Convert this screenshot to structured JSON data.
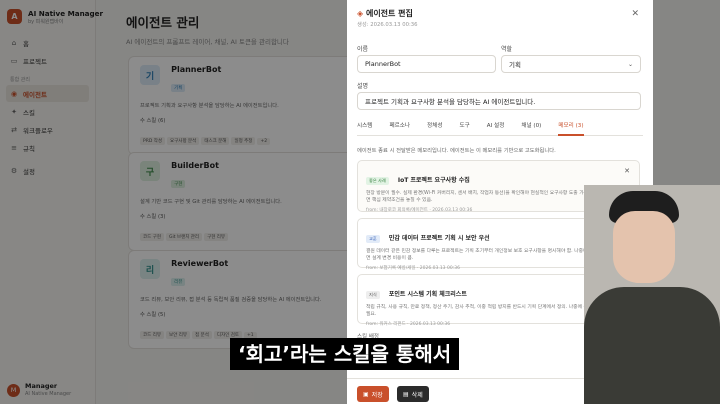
{
  "app": {
    "title": "AI Native Manager",
    "subtitle": "by 피워원랩바이"
  },
  "sidebar": {
    "items": [
      {
        "label": "홈",
        "icon": "home-icon",
        "glyph": "⌂"
      },
      {
        "label": "프로젝트",
        "icon": "folder-icon",
        "glyph": "▭"
      }
    ],
    "section_label": "통합 관리",
    "section_items": [
      {
        "label": "에이전트",
        "icon": "bot-icon",
        "glyph": "◉",
        "active": true
      },
      {
        "label": "스킬",
        "icon": "skill-icon",
        "glyph": "✦"
      },
      {
        "label": "워크플로우",
        "icon": "workflow-icon",
        "glyph": "⇄"
      },
      {
        "label": "규칙",
        "icon": "rule-icon",
        "glyph": "≡"
      },
      {
        "label": "설정",
        "icon": "gear-icon",
        "glyph": "⚙"
      }
    ]
  },
  "user": {
    "initial": "M",
    "name": "Manager",
    "role": "AI Native Manager"
  },
  "page": {
    "title": "에이전트 관리",
    "subtitle": "AI 에이전트의 프롬프트 레이어, 채널, AI 토큰을 관리합니다"
  },
  "agents": [
    {
      "initial": "기",
      "name": "PlannerBot",
      "tag": "기획",
      "color": "#2f7fb8",
      "bg": "#dcecf7",
      "desc": "프로젝트 기획과 요구사항 분석을 담당하는 AI 에이전트입니다.",
      "skills_label": "수 스킬 (6)",
      "chips": [
        "PRD 작성",
        "요구사항 분석",
        "태스크 분해",
        "일정 추정",
        "+2"
      ]
    },
    {
      "initial": "구",
      "name": "BuilderBot",
      "tag": "구현",
      "color": "#3c8a4a",
      "bg": "#dff0e1",
      "desc": "설계 기반 코드 구현 및 Git 관리를 담당하는 AI 에이전트입니다.",
      "skills_label": "수 스킬 (3)",
      "chips": [
        "코드 구현",
        "Git 브랜치 관리",
        "구현 리뷰"
      ]
    },
    {
      "initial": "리",
      "name": "ReviewerBot",
      "tag": "리뷰",
      "color": "#2f8f8a",
      "bg": "#dcf0ee",
      "desc": "코드 리뷰, 보안 리뷰, 접 분석 등 독립적 품질 검증을 담당하는 AI 에이전트입니다.",
      "skills_label": "수 스킬 (5)",
      "chips": [
        "코드 리뷰",
        "보안 리뷰",
        "접 분석",
        "디자인 검토",
        "+1"
      ]
    }
  ],
  "panel": {
    "title": "에이전트 편집",
    "created": "생성: 2026.03.13 00:36",
    "name_label": "이름",
    "name_value": "PlannerBot",
    "role_label": "역할",
    "role_value": "기획",
    "desc_label": "설명",
    "desc_value": "프로젝트 기획과 요구사항 분석을 담당하는 AI 에이전트입니다.",
    "tabs": [
      "시스템",
      "페르소나",
      "정체성",
      "도구",
      "AI 설정",
      "채널 (0)",
      "메모리 (3)"
    ],
    "active_tab": 6,
    "memory_info": "에이전트 종료 시 전달받은 메모리입니다. 에이전트는 이 메모리를 기반으로 고도화됩니다.",
    "memories": [
      {
        "badge": "좋은 사례",
        "badge_color": "#2f7d3a",
        "badge_bg": "#e2f3e4",
        "title": "IoT 프로젝트 요구사항 수집",
        "body": "현장 방문이 필수. 실제 환경(Wi-Fi 커버리지, 센서 배치, 작업자 동선)을 확인해야 현실적인 요구사항 도출 가능. 원격으로만 진행하면 핵심 제약조건을 놓칠 수 있음.",
        "from": "from: 내장로코 회의록/에이전트 · 2026.03.13 00:36"
      },
      {
        "badge": "교훈",
        "badge_color": "#3a64b8",
        "badge_bg": "#e2ebf8",
        "title": "민감 데이터 프로젝트 기획 시 보안 우선",
        "body": "결원 데이터 같은 민감 정보를 다루는 프로젝트는 기획 초기부터 개인정보 보호 요구사항을 명시해야 함. 나중에 보안 요건을 추가하면 설계 변경 비용이 큼.",
        "from": "from: 보험기록 예방/세일 · 2026.03.13 00:36"
      },
      {
        "badge": "지식",
        "badge_color": "#555555",
        "badge_bg": "#eeeeee",
        "title": "포인트 시스템 기획 체크리스트",
        "body": "적립 규칙, 사용 규칙, 만료 정책, 정산 주기, 감사 추적, 이중 적립 방지를 반드시 기획 단계에서 정의. 나중에 추가하면 아키텍처 변경 필요.",
        "from": "from: 워커스 리펀드 · 2026.03.13 00:36"
      }
    ],
    "skills_label": "스킬 배정",
    "skill_badges": [
      "편집",
      "편집"
    ],
    "save_label": "저장",
    "delete_label": "삭제"
  },
  "caption": "‘회고’라는 스킬을 통해서"
}
